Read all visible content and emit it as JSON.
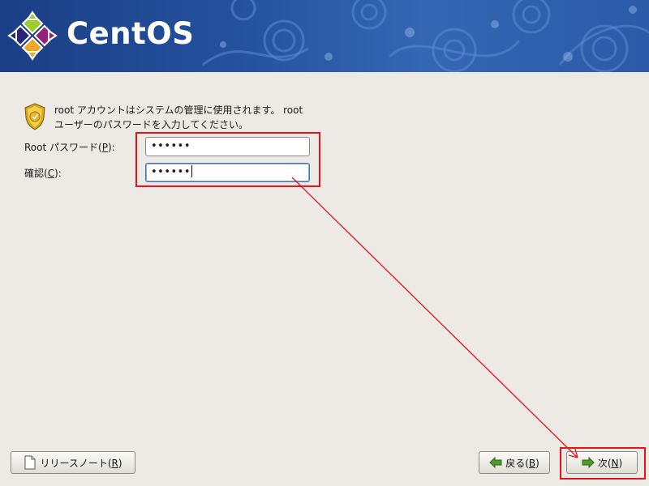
{
  "banner": {
    "logo_text": "CentOS",
    "logo_icon": "centos-logo-icon",
    "bg_color": "#24509c"
  },
  "intro": {
    "icon": "shield-badge-icon",
    "text_line1": "root アカウントはシステムの管理に使用されます。 root",
    "text_line2": "ユーザーのパスワードを入力してください。"
  },
  "form": {
    "password_label_prefix": "Root パスワード(",
    "password_mnemonic": "P",
    "password_label_suffix": "):",
    "password_value": "••••••",
    "confirm_label_prefix": "確認(",
    "confirm_mnemonic": "C",
    "confirm_label_suffix": "):",
    "confirm_value": "••••••"
  },
  "buttons": {
    "release_notes_prefix": "リリースノート(",
    "release_notes_mnemonic": "R",
    "release_notes_suffix": ")",
    "back_prefix": "戻る(",
    "back_mnemonic": "B",
    "back_suffix": ")",
    "next_prefix": "次(",
    "next_mnemonic": "N",
    "next_suffix": ")"
  },
  "annotation": {
    "highlight_color": "#e3141a"
  }
}
